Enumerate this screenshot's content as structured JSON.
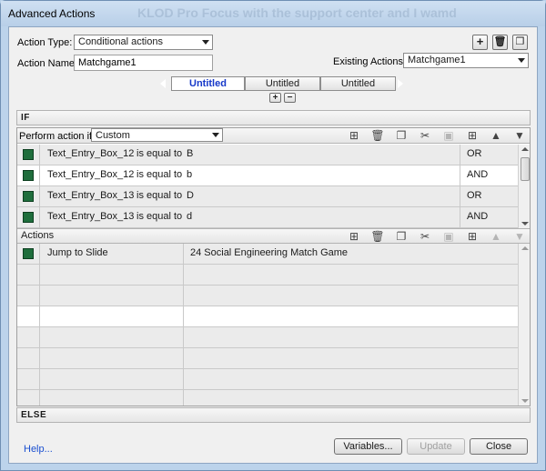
{
  "window": {
    "title": "Advanced Actions",
    "ghost_title": "KLOD Pro Focus with the support center and I  wamd"
  },
  "action_type": {
    "label": "Action Type:",
    "value": "Conditional actions"
  },
  "action_name": {
    "label": "Action Name:",
    "value": "Matchgame1"
  },
  "existing_actions": {
    "label": "Existing Actions:",
    "value": "Matchgame1"
  },
  "header_buttons": [
    "add-icon",
    "trash-icon",
    "duplicate-icon"
  ],
  "tabs": [
    {
      "label": "Untitled",
      "active": true
    },
    {
      "label": "Untitled",
      "active": false
    },
    {
      "label": "Untitled",
      "active": false
    }
  ],
  "tab_controls": {
    "add": "+",
    "remove": "−"
  },
  "if_section": {
    "header": "IF",
    "perform_label": "Perform action if:",
    "perform_value": "Custom",
    "rows": [
      {
        "variable": "Text_Entry_Box_12",
        "operator": "is equal to",
        "value": "B",
        "logic": "OR"
      },
      {
        "variable": "Text_Entry_Box_12",
        "operator": "is equal to",
        "value": "b",
        "logic": "AND"
      },
      {
        "variable": "Text_Entry_Box_13",
        "operator": "is equal to",
        "value": "D",
        "logic": "OR"
      },
      {
        "variable": "Text_Entry_Box_13",
        "operator": "is equal to",
        "value": "d",
        "logic": "AND"
      }
    ]
  },
  "actions_section": {
    "header": "Actions",
    "rows": [
      {
        "action": "Jump to Slide",
        "target": "24 Social Engineering Match Game"
      },
      {
        "action": "",
        "target": ""
      },
      {
        "action": "",
        "target": ""
      },
      {
        "action": "",
        "target": ""
      },
      {
        "action": "",
        "target": ""
      },
      {
        "action": "",
        "target": ""
      },
      {
        "action": "",
        "target": ""
      },
      {
        "action": "",
        "target": ""
      }
    ]
  },
  "else_section": {
    "header": "ELSE"
  },
  "footer": {
    "help": "Help...",
    "variables": "Variables...",
    "update": "Update",
    "close": "Close"
  },
  "colors": {
    "row_marker": "#1f6e3c",
    "active_tab": "#1638c9",
    "link": "#1a4fd0"
  }
}
